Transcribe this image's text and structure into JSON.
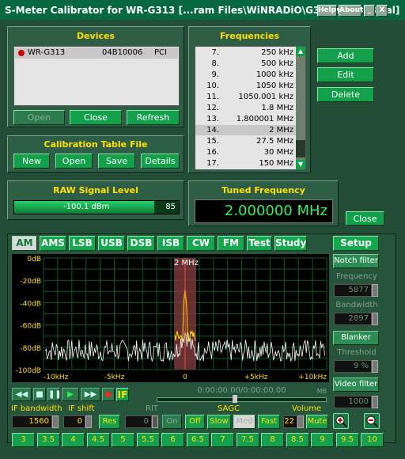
{
  "window": {
    "title": "S-Meter Calibrator for WR-G313 [...ram Files\\WiNRADiO\\G313\\wrg313.cal]",
    "help": "Help",
    "about": "About",
    "minimize": "_",
    "close": "X"
  },
  "devices": {
    "title": "Devices",
    "item": {
      "name": "WR-G313",
      "serial": "04B10006",
      "bus": "PCI"
    },
    "open": "Open",
    "close": "Close",
    "refresh": "Refresh"
  },
  "frequencies": {
    "title": "Frequencies",
    "items": [
      {
        "n": "7.",
        "v": "250 kHz"
      },
      {
        "n": "8.",
        "v": "500 kHz"
      },
      {
        "n": "9.",
        "v": "1000 kHz"
      },
      {
        "n": "10.",
        "v": "1050 kHz"
      },
      {
        "n": "11.",
        "v": "1050.001 kHz"
      },
      {
        "n": "12.",
        "v": "1.8 MHz"
      },
      {
        "n": "13.",
        "v": "1.800001 MHz"
      },
      {
        "n": "14.",
        "v": "2 MHz"
      },
      {
        "n": "15.",
        "v": "27.5 MHz"
      },
      {
        "n": "16.",
        "v": "30 MHz"
      },
      {
        "n": "17.",
        "v": "150 MHz"
      }
    ],
    "add": "Add",
    "edit": "Edit",
    "delete": "Delete"
  },
  "cal_file": {
    "title": "Calibration Table File",
    "new": "New",
    "open": "Open",
    "save": "Save",
    "details": "Details"
  },
  "raw": {
    "title": "RAW Signal Level",
    "level": "-100.1 dBm",
    "value": "85",
    "fill": 0.85
  },
  "tuned": {
    "title": "Tuned Frequency",
    "value": "2.000000 MHz",
    "close": "Close"
  },
  "modes": [
    "AM",
    "AMS",
    "LSB",
    "USB",
    "DSB",
    "ISB",
    "CW",
    "FM",
    "Test",
    "Study"
  ],
  "active_mode": "AM",
  "setup": "Setup",
  "spectrum": {
    "marker": "2 MHz",
    "ylabels": [
      "0dB",
      "-20dB",
      "-40dB",
      "-60dB",
      "-80dB",
      "-100dB"
    ],
    "xlabels": [
      "-10kHz",
      "-5kHz",
      "0",
      "+5kHz",
      "+10kHz"
    ]
  },
  "side": {
    "notch": "Notch filter",
    "frequency_label": "Frequency",
    "frequency": "5877",
    "bandwidth_label": "Bandwidth",
    "bandwidth": "2897",
    "blanker": "Blanker",
    "threshold_label": "Threshold",
    "threshold": "9 %",
    "video": "Video filter",
    "video_value": "1000"
  },
  "player": {
    "time": "0:00:00.00/0:00:00.00",
    "unit": "MB",
    "if": "IF"
  },
  "bottom": {
    "ifbw_label": "IF bandwidth",
    "ifbw": "1560",
    "ifshift_label": "IF shift",
    "ifshift": "0",
    "res": "Res",
    "rit_label": "RIT",
    "rit": "0",
    "sagc_label": "SAGC",
    "on": "On",
    "off": "Off",
    "slow": "Slow",
    "med": "Med",
    "fast": "Fast",
    "volume_label": "Volume",
    "volume": "22",
    "mute": "Mute"
  },
  "steps": [
    "3",
    "3.5",
    "4",
    "4.5",
    "5",
    "5.5",
    "6",
    "6.5",
    "7",
    "7.5",
    "8",
    "8.5",
    "9",
    "9.5",
    "10"
  ]
}
